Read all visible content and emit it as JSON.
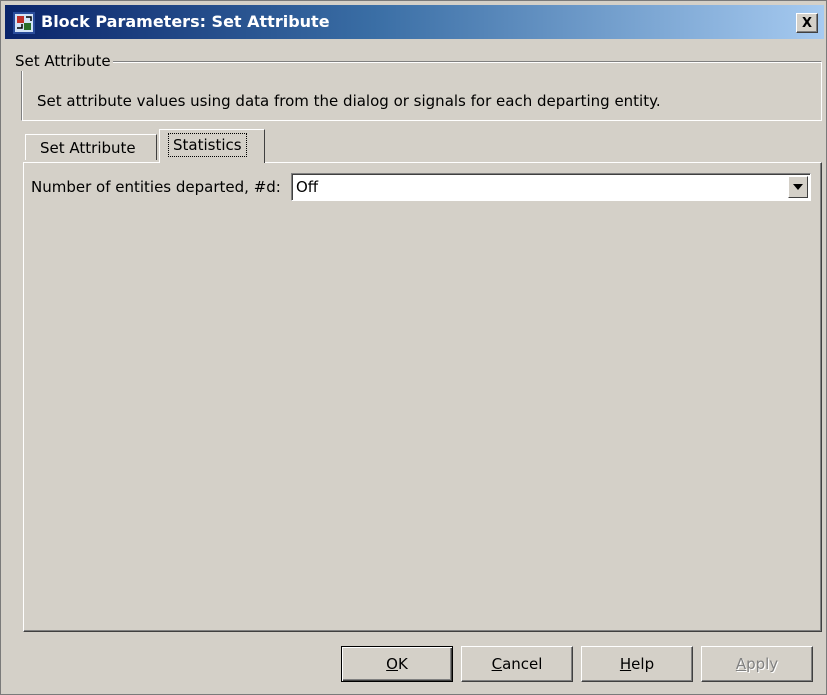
{
  "window": {
    "title": "Block Parameters: Set Attribute",
    "close_label": "X"
  },
  "description": {
    "group_title": "Set Attribute",
    "text": "Set attribute values using data from the dialog or signals for each departing entity."
  },
  "tabs": [
    {
      "label": "Set Attribute",
      "selected": false
    },
    {
      "label": "Statistics",
      "selected": true
    }
  ],
  "statistics": {
    "departed_label": "Number of entities departed, #d:",
    "departed_value": "Off"
  },
  "buttons": {
    "ok": {
      "accel": "O",
      "rest": "K"
    },
    "cancel": {
      "accel": "C",
      "rest": "ancel"
    },
    "help": {
      "accel": "H",
      "rest": "elp"
    },
    "apply": {
      "accel": "A",
      "rest": "pply",
      "enabled": false
    }
  },
  "colors": {
    "dialog_background": "#d4d0c8",
    "titlebar_start": "#0a246a",
    "titlebar_end": "#a6caf0"
  }
}
